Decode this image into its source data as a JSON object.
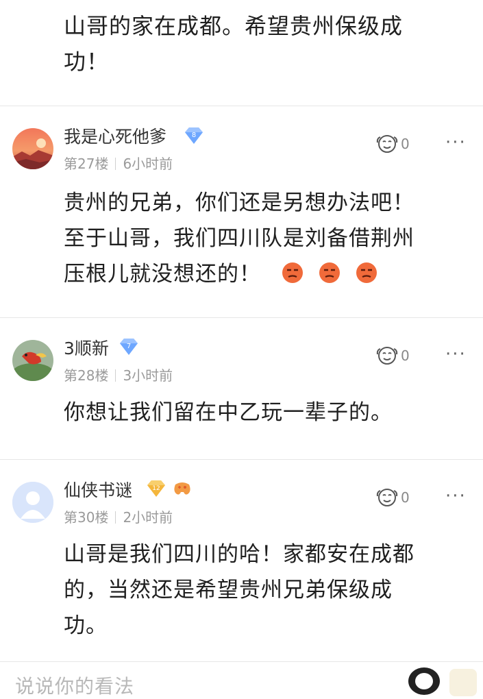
{
  "top_comment": {
    "text_line1": "山哥的家在成都。希望贵州保级成",
    "text_line2": "功！"
  },
  "comments": [
    {
      "username": "我是心死他爹",
      "level": "8",
      "floor": "第27楼",
      "time": "6小时前",
      "likes": "0",
      "more": "···",
      "text": [
        "贵州的兄弟，你们还是另想办法吧！",
        "至于山哥，我们四川队是刘备借荆州",
        "压根儿就没想还的！"
      ]
    },
    {
      "username": "3顺新",
      "level": "7",
      "floor": "第28楼",
      "time": "3小时前",
      "likes": "0",
      "more": "···",
      "text": [
        "你想让我们留在中乙玩一辈子的。"
      ]
    },
    {
      "username": "仙侠书谜",
      "level": "12",
      "floor": "第30楼",
      "time": "2小时前",
      "likes": "0",
      "more": "···",
      "text": [
        "山哥是我们四川的哈！家都安在成都",
        "的，当然还是希望贵州兄弟保级成",
        "功。"
      ]
    }
  ],
  "input": {
    "placeholder": "说说你的看法"
  },
  "colors": {
    "badge_blue": "#6ea7ff",
    "badge_gold": "#f4b63c",
    "emoji_orange": "#f06a3a"
  },
  "icons": [
    "like-emoji-icon",
    "more-icon",
    "level-badge-icon",
    "smirk-emoji-icon",
    "game-badge-icon",
    "avatar-icon"
  ]
}
